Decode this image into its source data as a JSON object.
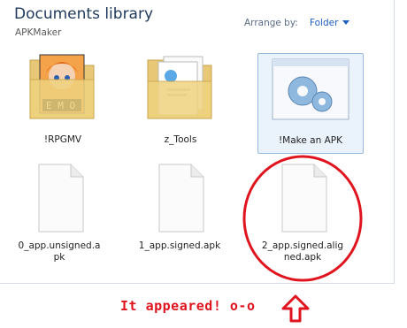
{
  "library": {
    "title": "Documents library",
    "subtitle": "APKMaker",
    "arrange_label": "Arrange by:",
    "arrange_value": "Folder"
  },
  "items": [
    {
      "label": "!RPGMV",
      "icon": "folder-anime-icon"
    },
    {
      "label": "z_Tools",
      "icon": "folder-documents-icon"
    },
    {
      "label": "!Make an APK",
      "icon": "gears-shortcut-icon"
    },
    {
      "label": "0_app.unsigned.a\npk",
      "icon": "blank-file-icon"
    },
    {
      "label": "1_app.signed.apk",
      "icon": "blank-file-icon"
    },
    {
      "label": "2_app.signed.alig\nned.apk",
      "icon": "blank-file-icon"
    }
  ],
  "annotation": {
    "text": "It appeared!  o-o",
    "color": "#e0141e"
  }
}
